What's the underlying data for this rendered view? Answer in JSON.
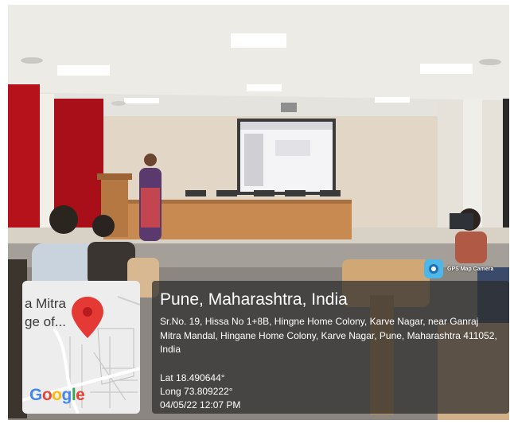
{
  "photo": {
    "scene": "seminar-hall-presentation",
    "colors": {
      "ceiling": "#e6e5df",
      "curtain": "#b5121b",
      "stage": "#c98a52",
      "screen": "#f4f4f6"
    }
  },
  "gps_badge": {
    "label": "GPS Map Camera",
    "icon": "camera-icon"
  },
  "map": {
    "place_text_line1": "a Mitra",
    "place_text_line2": "ge of...",
    "marker_icon": "map-pin-icon",
    "logo_text": "Google"
  },
  "location": {
    "city": "Pune, Maharashtra, India",
    "address": "Sr.No. 19, Hissa No 1+8B, Hingne Home Colony, Karve Nagar, near Ganraj Mitra Mandal, Hingane Home Colony, Karve Nagar, Pune, Maharashtra 411052, India",
    "latitude": "Lat 18.490644°",
    "longitude": "Long 73.809222°",
    "datetime": "04/05/22 12:07 PM"
  }
}
